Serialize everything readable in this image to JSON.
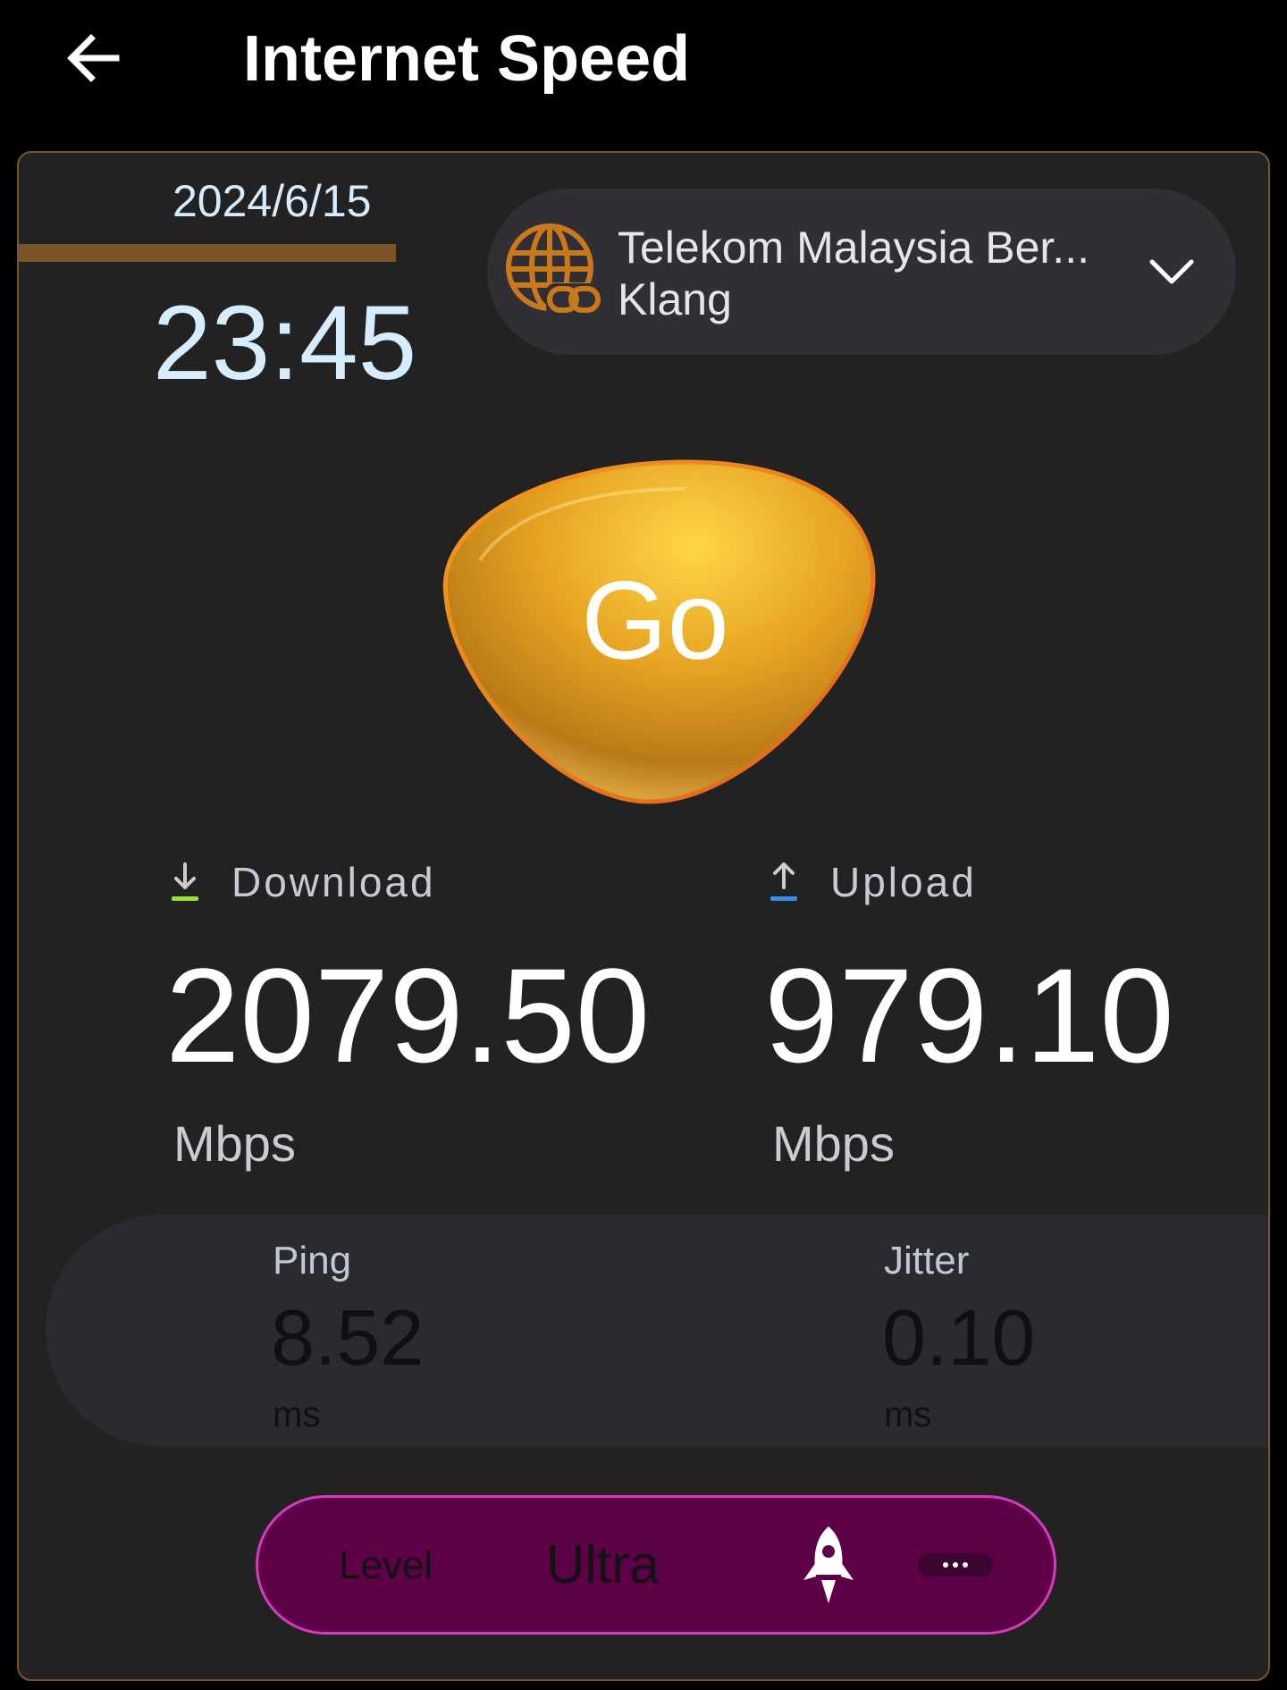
{
  "header": {
    "title": "Internet Speed",
    "back_icon": "arrow-left-icon"
  },
  "timestamp": {
    "date": "2024/6/15",
    "time": "23:45"
  },
  "server": {
    "isp_name": "Telekom Malaysia Ber...",
    "location": "Klang",
    "icon": "globe-link-icon",
    "dropdown_icon": "chevron-down-icon"
  },
  "go_button": {
    "label": "Go"
  },
  "download": {
    "label": "Download",
    "value": "2079.50",
    "unit": "Mbps",
    "icon": "download-arrow-icon"
  },
  "upload": {
    "label": "Upload",
    "value": "979.10",
    "unit": "Mbps",
    "icon": "upload-arrow-icon"
  },
  "ping": {
    "label": "Ping",
    "value": "8.52",
    "unit": "ms"
  },
  "jitter": {
    "label": "Jitter",
    "value": "0.10",
    "unit": "ms"
  },
  "level": {
    "label": "Level",
    "value": "Ultra",
    "icon": "rocket-icon",
    "more_icon": "more-dots-icon"
  },
  "colors": {
    "background": "#000000",
    "card": "#222222",
    "card_border": "#7a5430",
    "accent_gold": "#e6a020",
    "date_text": "#d6ecff",
    "download_accent": "#9be22d",
    "upload_accent": "#3b8ef0",
    "level_pill": "#5e0048",
    "level_border": "#d63bbf"
  }
}
